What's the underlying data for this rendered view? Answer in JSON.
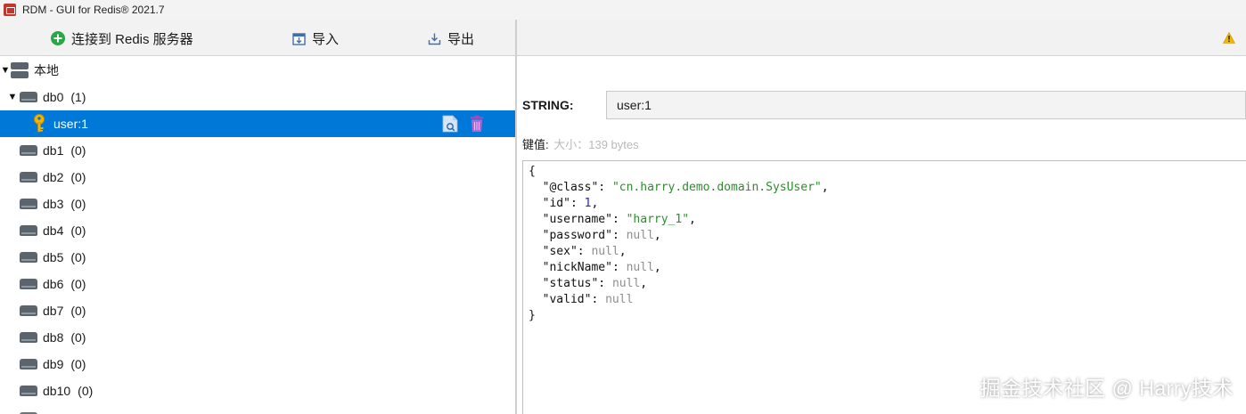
{
  "window": {
    "title": "RDM - GUI for Redis® 2021.7"
  },
  "toolbar": {
    "connect_label": "连接到 Redis 服务器",
    "import_label": "导入",
    "export_label": "导出"
  },
  "tree": {
    "server": {
      "name": "本地",
      "expanded": true
    },
    "dbs": [
      {
        "name": "db0",
        "count": "(1)",
        "expanded": true
      },
      {
        "name": "db1",
        "count": "(0)"
      },
      {
        "name": "db2",
        "count": "(0)"
      },
      {
        "name": "db3",
        "count": "(0)"
      },
      {
        "name": "db4",
        "count": "(0)"
      },
      {
        "name": "db5",
        "count": "(0)"
      },
      {
        "name": "db6",
        "count": "(0)"
      },
      {
        "name": "db7",
        "count": "(0)"
      },
      {
        "name": "db8",
        "count": "(0)"
      },
      {
        "name": "db9",
        "count": "(0)"
      },
      {
        "name": "db10",
        "count": "(0)"
      }
    ],
    "selected_key": {
      "name": "user:1",
      "icons": [
        "console-icon",
        "delete-icon"
      ]
    }
  },
  "key_view": {
    "type_label": "STRING:",
    "key_name": "user:1",
    "value_label": "键值:",
    "value_size": "大小：139 bytes",
    "json_lines": [
      [
        {
          "t": "p",
          "v": "{"
        }
      ],
      [
        {
          "t": "p",
          "v": "  "
        },
        {
          "t": "p",
          "v": "\"@class\""
        },
        {
          "t": "p",
          "v": ": "
        },
        {
          "t": "s",
          "v": "\"cn.harry.demo.domain.SysUser\""
        },
        {
          "t": "p",
          "v": ","
        }
      ],
      [
        {
          "t": "p",
          "v": "  "
        },
        {
          "t": "p",
          "v": "\"id\""
        },
        {
          "t": "p",
          "v": ": "
        },
        {
          "t": "n",
          "v": "1"
        },
        {
          "t": "p",
          "v": ","
        }
      ],
      [
        {
          "t": "p",
          "v": "  "
        },
        {
          "t": "p",
          "v": "\"username\""
        },
        {
          "t": "p",
          "v": ": "
        },
        {
          "t": "s",
          "v": "\"harry_1\""
        },
        {
          "t": "p",
          "v": ","
        }
      ],
      [
        {
          "t": "p",
          "v": "  "
        },
        {
          "t": "p",
          "v": "\"password\""
        },
        {
          "t": "p",
          "v": ": "
        },
        {
          "t": "nl",
          "v": "null"
        },
        {
          "t": "p",
          "v": ","
        }
      ],
      [
        {
          "t": "p",
          "v": "  "
        },
        {
          "t": "p",
          "v": "\"sex\""
        },
        {
          "t": "p",
          "v": ": "
        },
        {
          "t": "nl",
          "v": "null"
        },
        {
          "t": "p",
          "v": ","
        }
      ],
      [
        {
          "t": "p",
          "v": "  "
        },
        {
          "t": "p",
          "v": "\"nickName\""
        },
        {
          "t": "p",
          "v": ": "
        },
        {
          "t": "nl",
          "v": "null"
        },
        {
          "t": "p",
          "v": ","
        }
      ],
      [
        {
          "t": "p",
          "v": "  "
        },
        {
          "t": "p",
          "v": "\"status\""
        },
        {
          "t": "p",
          "v": ": "
        },
        {
          "t": "nl",
          "v": "null"
        },
        {
          "t": "p",
          "v": ","
        }
      ],
      [
        {
          "t": "p",
          "v": "  "
        },
        {
          "t": "p",
          "v": "\"valid\""
        },
        {
          "t": "p",
          "v": ": "
        },
        {
          "t": "nl",
          "v": "null"
        }
      ],
      [
        {
          "t": "p",
          "v": "}"
        }
      ]
    ]
  },
  "watermark": "掘金技术社区 @ Harry技术",
  "colors": {
    "selection": "#0078d7",
    "string": "#2e8b2e",
    "number": "#2525c8",
    "null": "#8e8e8e",
    "warning": "#f2b705"
  }
}
